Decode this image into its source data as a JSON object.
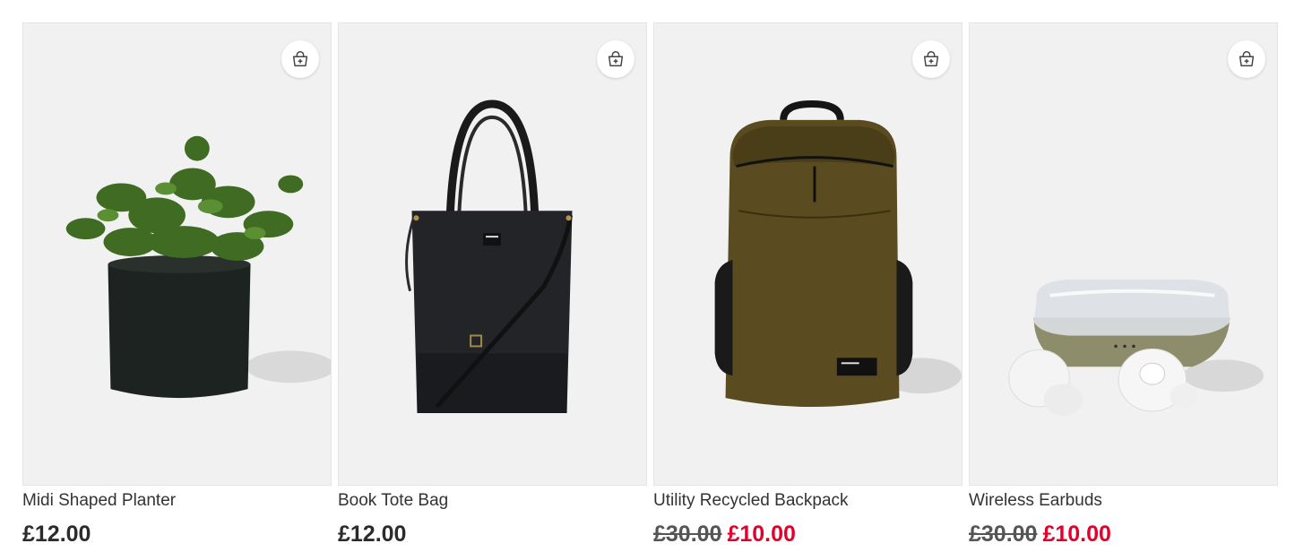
{
  "products": [
    {
      "name": "Midi Shaped Planter",
      "price": "£12.00",
      "was": "",
      "now": ""
    },
    {
      "name": "Book Tote Bag",
      "price": "£12.00",
      "was": "",
      "now": ""
    },
    {
      "name": "Utility Recycled Backpack",
      "price": "",
      "was": "£30.00",
      "now": "£10.00"
    },
    {
      "name": "Wireless Earbuds",
      "price": "",
      "was": "£30.00",
      "now": "£10.00"
    }
  ],
  "icons": {
    "add_to_bag": "bag-plus-icon"
  },
  "colors": {
    "sale": "#e4002b",
    "card_bg": "#f1f1f1"
  }
}
